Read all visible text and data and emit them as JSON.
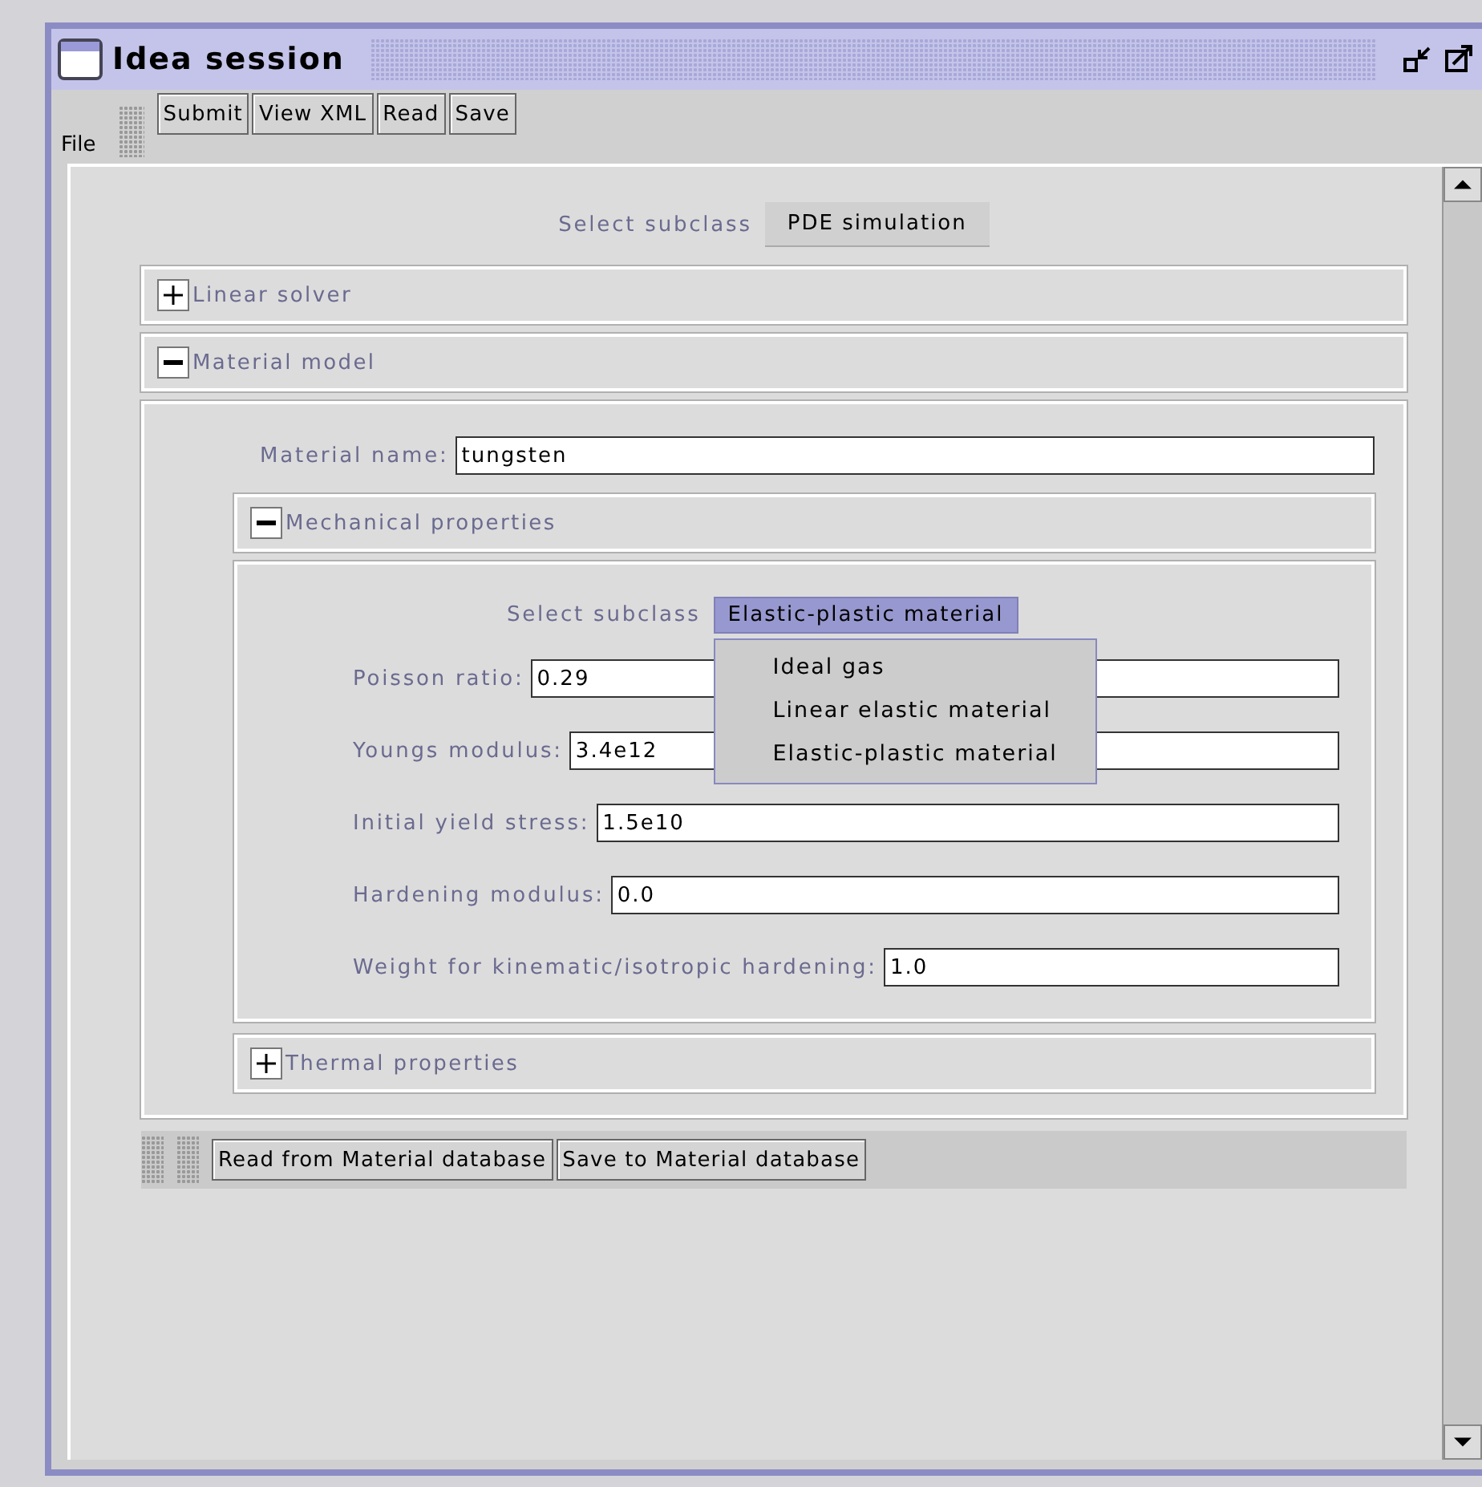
{
  "window": {
    "title": "Idea session"
  },
  "menu": [
    "File"
  ],
  "toolbar": [
    "Submit",
    "View XML",
    "Read",
    "Save"
  ],
  "subclass": {
    "label": "Select subclass",
    "value": "PDE simulation"
  },
  "sections": [
    {
      "title": "Linear solver",
      "expanded": false
    },
    {
      "title": "Material model",
      "expanded": true,
      "fields": [
        {
          "label": "Material name:",
          "value": "tungsten"
        }
      ],
      "subsections": [
        {
          "title": "Mechanical properties",
          "expanded": true,
          "subclass": {
            "label": "Select subclass",
            "value": "Elastic-plastic material",
            "menu_open": true,
            "options": [
              "Ideal gas",
              "Linear elastic material",
              "Elastic-plastic material"
            ]
          },
          "fields": [
            {
              "label": "Poisson ratio:",
              "value": "0.29"
            },
            {
              "label": "Youngs modulus:",
              "value": "3.4e12"
            },
            {
              "label": "Initial yield stress:",
              "value": "1.5e10"
            },
            {
              "label": "Hardening modulus:",
              "value": "0.0"
            },
            {
              "label": "Weight for kinematic/isotropic hardening:",
              "value": "1.0"
            }
          ]
        },
        {
          "title": "Thermal properties",
          "expanded": false
        }
      ],
      "buttons": [
        "Read from Material database",
        "Save to Material database"
      ]
    }
  ]
}
